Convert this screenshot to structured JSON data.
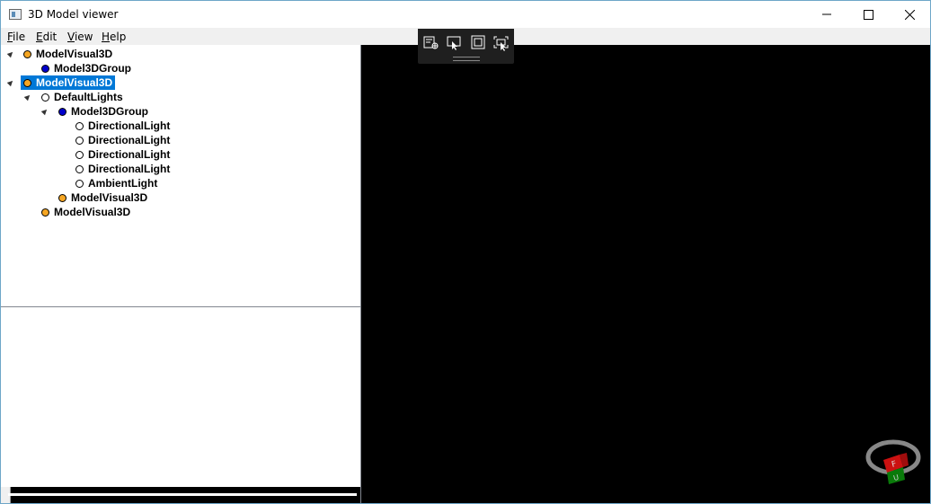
{
  "window": {
    "title": "3D Model viewer"
  },
  "menu": {
    "file": {
      "accel": "F",
      "rest": "ile"
    },
    "edit": {
      "accel": "E",
      "rest": "dit"
    },
    "view": {
      "accel": "V",
      "rest": "iew"
    },
    "help": {
      "accel": "H",
      "rest": "elp"
    }
  },
  "tree": {
    "items": [
      {
        "label": "ModelVisual3D",
        "type": "visual",
        "expanded": true,
        "selected": false
      },
      {
        "label": "Model3DGroup",
        "type": "group",
        "expanded": false,
        "selected": false
      },
      {
        "label": "ModelVisual3D",
        "type": "visual",
        "expanded": true,
        "selected": true
      },
      {
        "label": "DefaultLights",
        "type": "light",
        "expanded": true,
        "selected": false
      },
      {
        "label": "Model3DGroup",
        "type": "group",
        "expanded": true,
        "selected": false
      },
      {
        "label": "DirectionalLight",
        "type": "light",
        "expanded": false,
        "selected": false
      },
      {
        "label": "DirectionalLight",
        "type": "light",
        "expanded": false,
        "selected": false
      },
      {
        "label": "DirectionalLight",
        "type": "light",
        "expanded": false,
        "selected": false
      },
      {
        "label": "DirectionalLight",
        "type": "light",
        "expanded": false,
        "selected": false
      },
      {
        "label": "AmbientLight",
        "type": "light",
        "expanded": false,
        "selected": false
      },
      {
        "label": "ModelVisual3D",
        "type": "visual",
        "expanded": false,
        "selected": false
      },
      {
        "label": "ModelVisual3D",
        "type": "visual",
        "expanded": false,
        "selected": false
      }
    ]
  },
  "viewcube": {
    "front_label": "F",
    "bottom_label": "U"
  },
  "colors": {
    "selection": "#0078d7",
    "visual_dot": "#f5a623",
    "group_dot": "#0000cc",
    "viewport_bg": "#000000"
  }
}
